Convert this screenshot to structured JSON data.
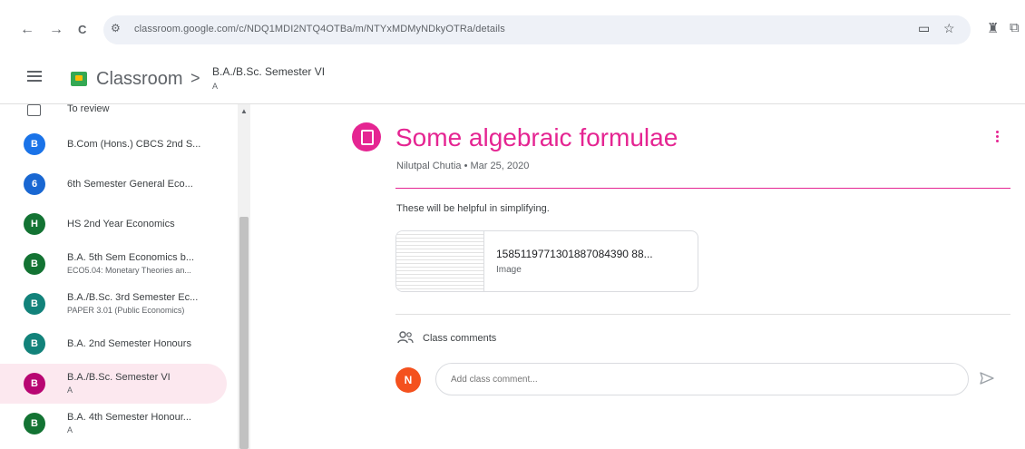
{
  "browser": {
    "url": "classroom.google.com/c/NDQ1MDI2NTQ4OTBa/m/NTYxMDMyNDkyOTRa/details",
    "back_glyph": "←",
    "forward_glyph": "→",
    "reload_glyph": "C"
  },
  "header": {
    "app_name": "Classroom",
    "separator": ">",
    "breadcrumb_title": "B.A./B.Sc. Semester VI",
    "breadcrumb_sub": "A"
  },
  "sidebar": {
    "review_label": "To review",
    "items": [
      {
        "initial": "B",
        "color": "#1a73e8",
        "name": "B.Com (Hons.) CBCS 2nd S...",
        "sub": ""
      },
      {
        "initial": "6",
        "color": "#1967d2",
        "name": "6th Semester General Eco...",
        "sub": ""
      },
      {
        "initial": "H",
        "color": "#137333",
        "name": "HS 2nd Year Economics",
        "sub": ""
      },
      {
        "initial": "B",
        "color": "#137333",
        "name": "B.A. 5th Sem Economics b...",
        "sub": "ECO5.04: Monetary Theories an..."
      },
      {
        "initial": "B",
        "color": "#12827a",
        "name": "B.A./B.Sc. 3rd Semester Ec...",
        "sub": "PAPER 3.01 (Public Economics)"
      },
      {
        "initial": "B",
        "color": "#12827a",
        "name": "B.A. 2nd Semester Honours",
        "sub": ""
      },
      {
        "initial": "B",
        "color": "#b80672",
        "name": "B.A./B.Sc. Semester VI",
        "sub": "A",
        "active": true
      },
      {
        "initial": "B",
        "color": "#137333",
        "name": "B.A. 4th Semester Honour...",
        "sub": "A"
      }
    ]
  },
  "post": {
    "title": "Some algebraic formulae",
    "meta": "Nilutpal Chutia • Mar 25, 2020",
    "body": "These will be helpful in simplifying.",
    "attachment_name": "1585119771301887084390 88...",
    "attachment_type": "Image",
    "accent_color": "#e52592"
  },
  "comments": {
    "label": "Class comments",
    "user_initial": "N",
    "placeholder": "Add class comment..."
  }
}
